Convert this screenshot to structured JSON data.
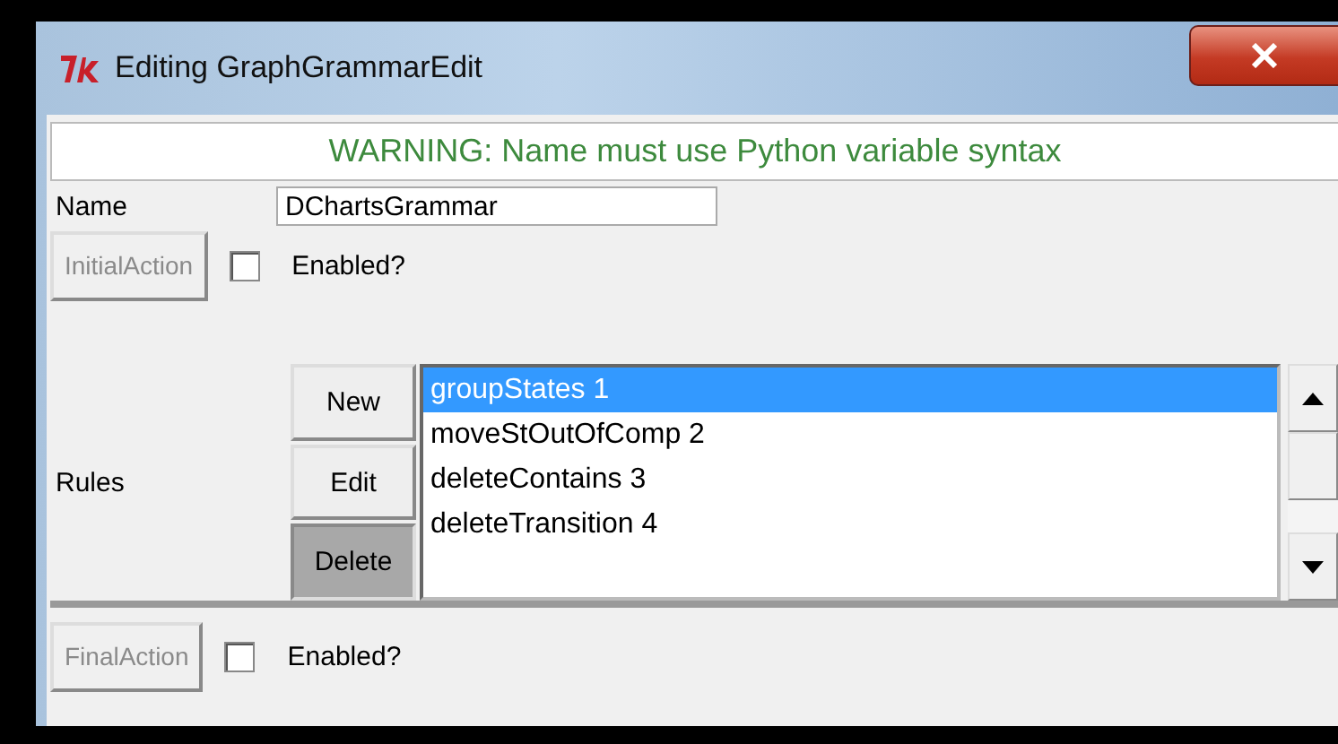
{
  "window": {
    "title": "Editing GraphGrammarEdit"
  },
  "warning": "WARNING: Name must use Python variable syntax",
  "name_row": {
    "label": "Name",
    "value": "DChartsGrammar"
  },
  "initial_action": {
    "label": "InitialAction",
    "disabled": true,
    "checkbox": {
      "label": "Enabled?",
      "checked": false
    }
  },
  "rules": {
    "label": "Rules",
    "buttons": [
      {
        "label": "New",
        "pressed": false
      },
      {
        "label": "Edit",
        "pressed": false
      },
      {
        "label": "Delete",
        "pressed": true
      }
    ],
    "items": [
      {
        "label": "groupStates 1",
        "selected": true
      },
      {
        "label": "moveStOutOfComp 2",
        "selected": false
      },
      {
        "label": "deleteContains 3",
        "selected": false
      },
      {
        "label": "deleteTransition 4",
        "selected": false
      }
    ]
  },
  "final_action": {
    "label": "FinalAction",
    "disabled": true,
    "checkbox": {
      "label": "Enabled?",
      "checked": false
    }
  }
}
